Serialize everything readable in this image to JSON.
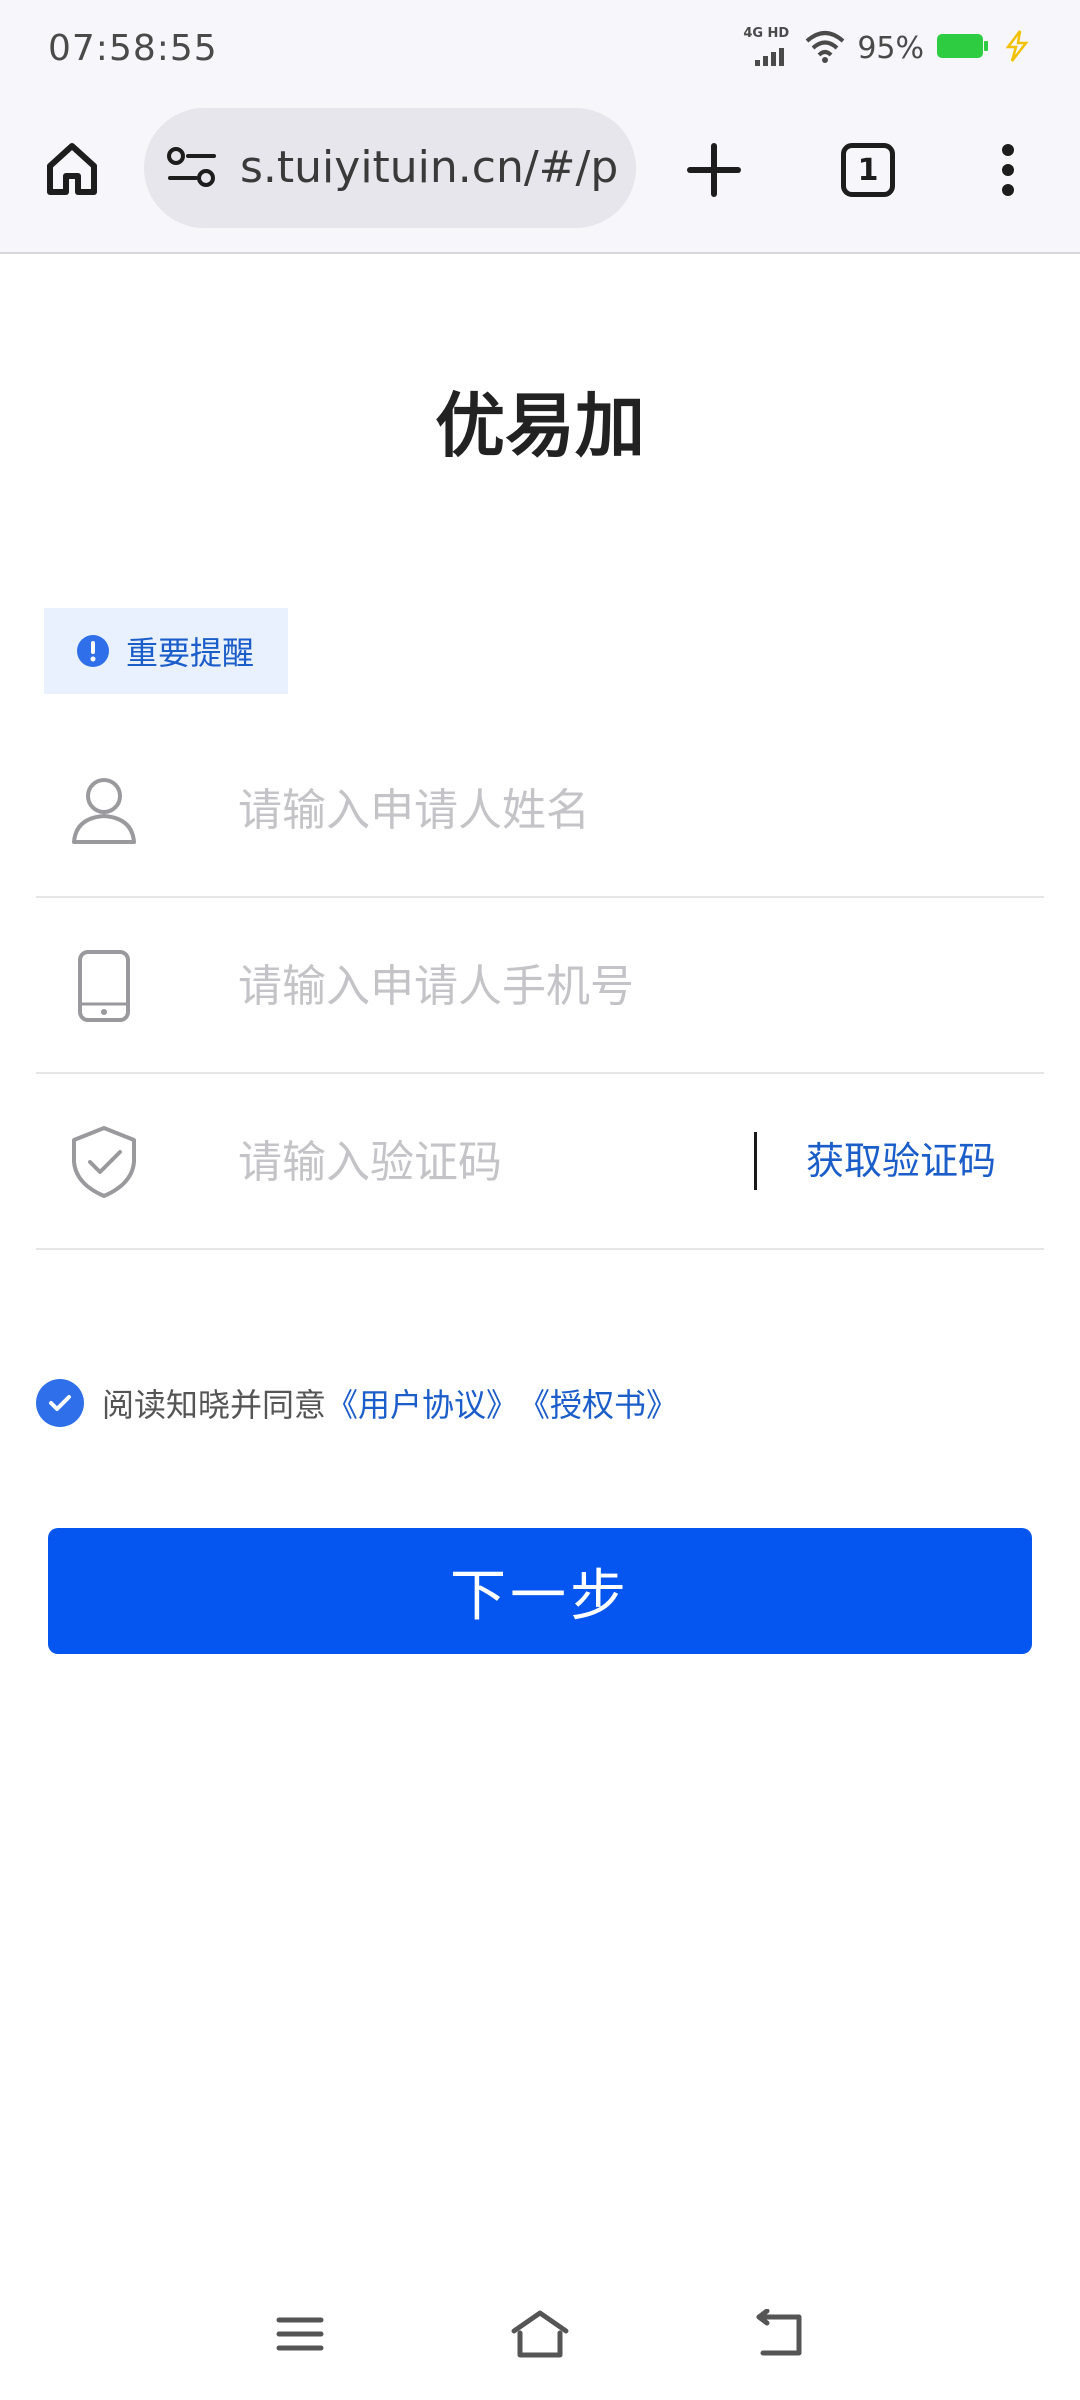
{
  "status_bar": {
    "time": "07:58:55",
    "network": "4G HD",
    "battery": "95%"
  },
  "browser": {
    "url": "s.tuiyituin.cn/#/pa",
    "tab_count": "1"
  },
  "page": {
    "title": "优易加",
    "notice": "重要提醒",
    "fields": {
      "name_placeholder": "请输入申请人姓名",
      "phone_placeholder": "请输入申请人手机号",
      "code_placeholder": "请输入验证码",
      "get_code": "获取验证码"
    },
    "agreement": {
      "text": "阅读知晓并同意",
      "user_agreement": "《用户协议》",
      "authorization": "《授权书》",
      "checked": true
    },
    "next_button": "下一步"
  },
  "colors": {
    "accent": "#0555f0",
    "link": "#1b5dc9",
    "notice_bg": "#e8f1fd",
    "checkbox": "#2f6fe9",
    "battery": "#2ecc40"
  },
  "icons": {
    "status": [
      "signal-icon",
      "wifi-icon",
      "battery-icon",
      "charging-icon"
    ],
    "browser": [
      "home-icon",
      "site-settings-icon",
      "plus-icon",
      "tabs-icon",
      "more-vert-icon"
    ],
    "fields": [
      "user-icon",
      "phone-icon",
      "shield-check-icon"
    ],
    "nav": [
      "menu-icon",
      "home-icon",
      "back-icon"
    ]
  }
}
